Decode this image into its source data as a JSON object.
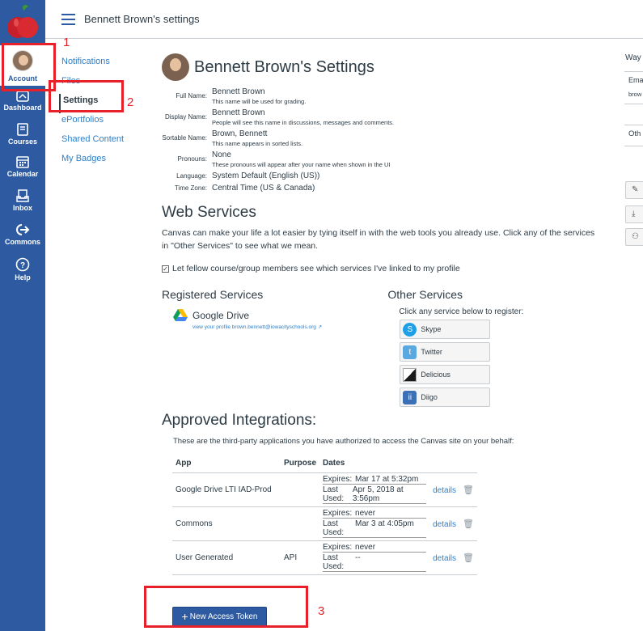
{
  "global_nav": {
    "items": [
      {
        "label": "Account",
        "icon": "avatar"
      },
      {
        "label": "Dashboard",
        "icon": "dashboard-icon"
      },
      {
        "label": "Courses",
        "icon": "courses-icon"
      },
      {
        "label": "Calendar",
        "icon": "calendar-icon"
      },
      {
        "label": "Inbox",
        "icon": "inbox-icon"
      },
      {
        "label": "Commons",
        "icon": "commons-icon"
      },
      {
        "label": "Help",
        "icon": "help-icon"
      }
    ],
    "accent": "#2d5aa0"
  },
  "header": {
    "breadcrumb": "Bennett Brown's settings"
  },
  "subnav": {
    "items": [
      "Notifications",
      "Files",
      "Settings",
      "ePortfolios",
      "Shared Content",
      "My Badges"
    ],
    "active": "Settings"
  },
  "page": {
    "title": "Bennett Brown's Settings",
    "profile": [
      {
        "label": "Full Name:",
        "value": "Bennett Brown",
        "hint": "This name will be used for grading."
      },
      {
        "label": "Display Name:",
        "value": "Bennett Brown",
        "hint": "People will see this name in discussions, messages and comments."
      },
      {
        "label": "Sortable Name:",
        "value": "Brown, Bennett",
        "hint": "This name appears in sorted lists."
      },
      {
        "label": "Pronouns:",
        "value": "None",
        "hint": "These pronouns will appear after your name when shown in the UI"
      },
      {
        "label": "Language:",
        "value": "System Default (English (US))",
        "hint": ""
      },
      {
        "label": "Time Zone:",
        "value": "Central Time (US & Canada)",
        "hint": ""
      }
    ]
  },
  "web_services": {
    "heading": "Web Services",
    "description": "Canvas can make your life a lot easier by tying itself in with the web tools you already use. Click any of the services in \"Other Services\" to see what we mean.",
    "checkbox_label": "Let fellow course/group members see which services I've linked to my profile",
    "checkbox_checked": true,
    "registered": {
      "heading": "Registered Services",
      "service_name": "Google Drive",
      "profile_link": "view your profile brown.bennett@iowacityschools.org"
    },
    "other": {
      "heading": "Other Services",
      "help": "Click any service below to register:",
      "services": [
        {
          "name": "Skype",
          "color": "#1fa0e6"
        },
        {
          "name": "Twitter",
          "color": "#5aa8e0"
        },
        {
          "name": "Delicious",
          "color": "#1b1b1b"
        },
        {
          "name": "Diigo",
          "color": "#3b6fb6"
        }
      ]
    }
  },
  "integrations": {
    "heading": "Approved Integrations:",
    "description": "These are the third-party applications you have authorized to access the Canvas site on your behalf:",
    "columns": [
      "App",
      "Purpose",
      "Dates"
    ],
    "rows": [
      {
        "app": "Google Drive LTI IAD-Prod",
        "purpose": "",
        "expires_label": "Expires:",
        "expires": "Mar 17 at 5:32pm",
        "last_label": "Last Used:",
        "last": "Apr 5, 2018 at 3:56pm",
        "details": "details"
      },
      {
        "app": "Commons",
        "purpose": "",
        "expires_label": "Expires:",
        "expires": "never",
        "last_label": "Last Used:",
        "last": "Mar 3 at 4:05pm",
        "details": "details"
      },
      {
        "app": "User Generated",
        "purpose": "API",
        "expires_label": "Expires:",
        "expires": "never",
        "last_label": "Last Used:",
        "last": "--",
        "details": "details"
      }
    ],
    "new_token_label": "New Access Token"
  },
  "right_panel": {
    "heading": "Way",
    "email_label": "Ema",
    "email_value": "brow",
    "other_label": "Oth"
  },
  "annotations": {
    "labels": [
      "1",
      "2",
      "3"
    ],
    "color": "#e8202a"
  }
}
